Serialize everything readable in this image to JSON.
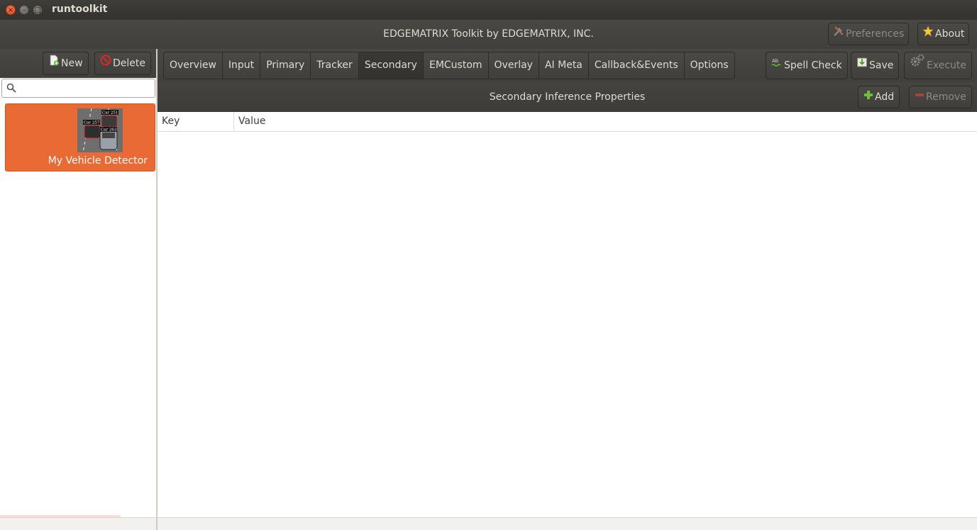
{
  "window": {
    "title": "runtoolkit",
    "close_glyph": "×",
    "minimize_glyph": "–",
    "maximize_glyph": "□"
  },
  "header": {
    "title": "EDGEMATRIX Toolkit by EDGEMATRIX, INC.",
    "preferences_label": "Preferences",
    "about_label": "About"
  },
  "sidebar": {
    "new_label": "New",
    "delete_label": "Delete",
    "search": {
      "value": "",
      "placeholder": ""
    },
    "items": [
      {
        "label": "My Vehicle Detector",
        "thumbnail_tags": [
          "Car 251",
          "Car 257",
          "Car 263"
        ]
      }
    ]
  },
  "main": {
    "tabs": [
      {
        "label": "Overview"
      },
      {
        "label": "Input"
      },
      {
        "label": "Primary"
      },
      {
        "label": "Tracker"
      },
      {
        "label": "Secondary"
      },
      {
        "label": "EMCustom"
      },
      {
        "label": "Overlay"
      },
      {
        "label": "AI Meta"
      },
      {
        "label": "Callback&Events"
      },
      {
        "label": "Options"
      }
    ],
    "spell_check_label": "Spell Check",
    "save_label": "Save",
    "execute_label": "Execute",
    "section_title": "Secondary Inference Properties",
    "add_label": "Add",
    "remove_label": "Remove",
    "table": {
      "columns": [
        "Key",
        "Value"
      ],
      "rows": []
    }
  },
  "colors": {
    "accent": "#ea6a36",
    "toolbar": "#43413d",
    "text_light": "#dfdbd2",
    "disabled_text": "#8c8a83"
  },
  "icons": {
    "preferences": "tools-icon",
    "about": "star-icon",
    "new": "new-document-icon",
    "delete": "no-entry-icon",
    "spell_check": "spell-check-icon",
    "save": "save-icon",
    "execute": "gears-icon",
    "add": "plus-icon",
    "remove": "minus-icon",
    "search": "search-icon"
  }
}
